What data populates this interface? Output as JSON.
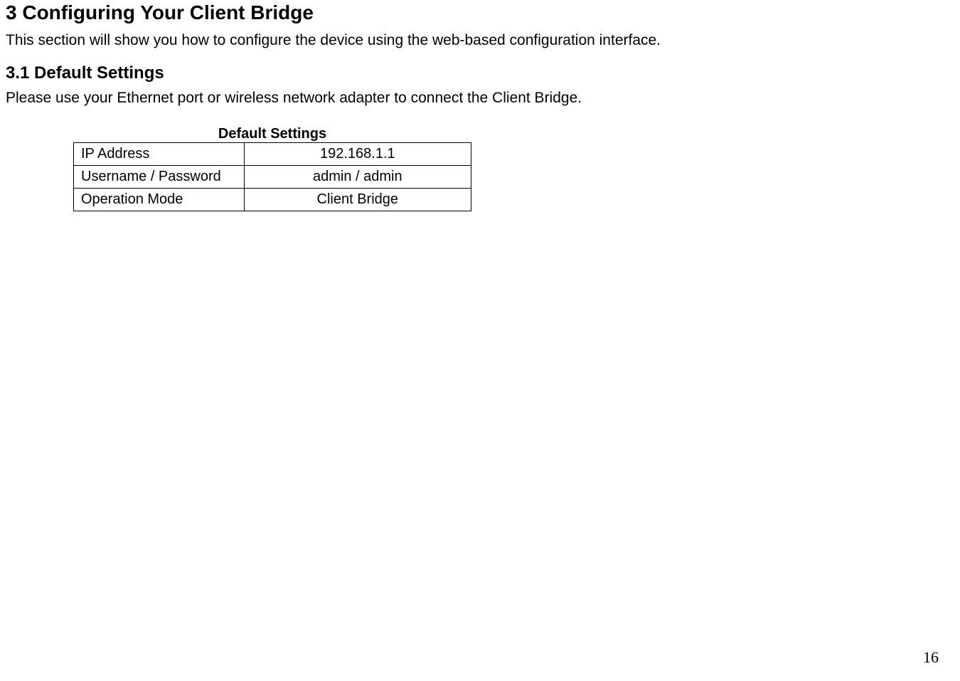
{
  "section": {
    "heading": "3  Configuring Your Client Bridge",
    "intro": "This section will show you how to configure the device using the web-based configuration interface."
  },
  "subsection": {
    "heading": "3.1   Default Settings",
    "intro": "Please use your Ethernet port or wireless network adapter to connect the Client Bridge."
  },
  "table": {
    "caption": "Default Settings",
    "rows": [
      {
        "label": "IP Address",
        "value": "192.168.1.1"
      },
      {
        "label": "Username / Password",
        "value": "admin / admin"
      },
      {
        "label": "Operation Mode",
        "value": "Client Bridge"
      }
    ]
  },
  "page_number": "16"
}
